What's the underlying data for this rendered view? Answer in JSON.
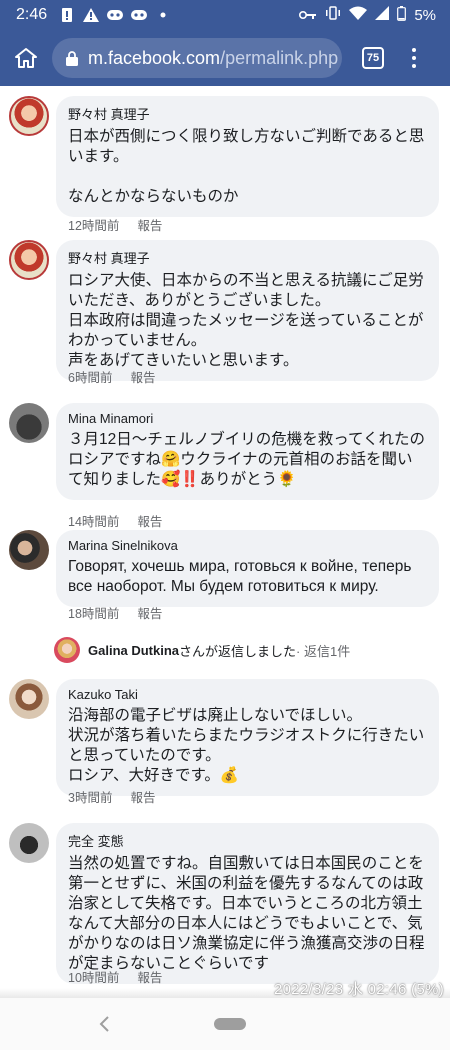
{
  "status": {
    "time": "2:46",
    "battery": "5%"
  },
  "browser": {
    "url_host": "m.facebook.com",
    "url_path": "/permalink.php",
    "tab_count": "75"
  },
  "comments": [
    {
      "author": "野々村 真理子",
      "text": "日本が西側につく限り致し方ないご判断であると思います。\n\nなんとかならないものか",
      "time": "12時間前",
      "report": "報告"
    },
    {
      "author": "野々村 真理子",
      "text": "ロシア大使、日本からの不当と思える抗議にご足労いただき、ありがとうございました。\n日本政府は間違ったメッセージを送っていることがわかっていません。\n声をあげてきいたいと思います。",
      "time": "6時間前",
      "report": "報告"
    },
    {
      "author": "Mina Minamori",
      "text": "３月12日〜チェルノブイリの危機を救ってくれたのロシアですね🤗ウクライナの元首相のお話を聞いて知りました🥰‼️ありがとう🌻",
      "time": "14時間前",
      "report": "報告"
    },
    {
      "author": "Marina Sinelnikova",
      "text": "Говорят, хочешь мира, готовься к войне, теперь все наоборот. Мы будем готовиться к миру.",
      "time": "18時間前",
      "report": "報告"
    },
    {
      "author": "Kazuko Taki",
      "text": "沿海部の電子ビザは廃止しないでほしい。\n状況が落ち着いたらまたウラジオストクに行きたいと思っていたのです。\nロシア、大好きです。💰",
      "time": "3時間前",
      "report": "報告"
    },
    {
      "author": "完全 変態",
      "text": "当然の処置ですね。自国敷いては日本国民のことを第一とせずに、米国の利益を優先するなんてのは政治家として失格です。日本でいうところの北方領土なんて大部分の日本人にはどうでもよいことで、気がかりなのは日ソ漁業協定に伴う漁獲高交渉の日程が定まらないことぐらいです",
      "time": "10時間前",
      "report": "報告"
    }
  ],
  "reply": {
    "name": "Galina Dutkina",
    "suffix": "さんが返信しました",
    "count": " · 返信1件"
  },
  "timestamp_overlay": "2022/3/23 水 02:46 (5%)"
}
